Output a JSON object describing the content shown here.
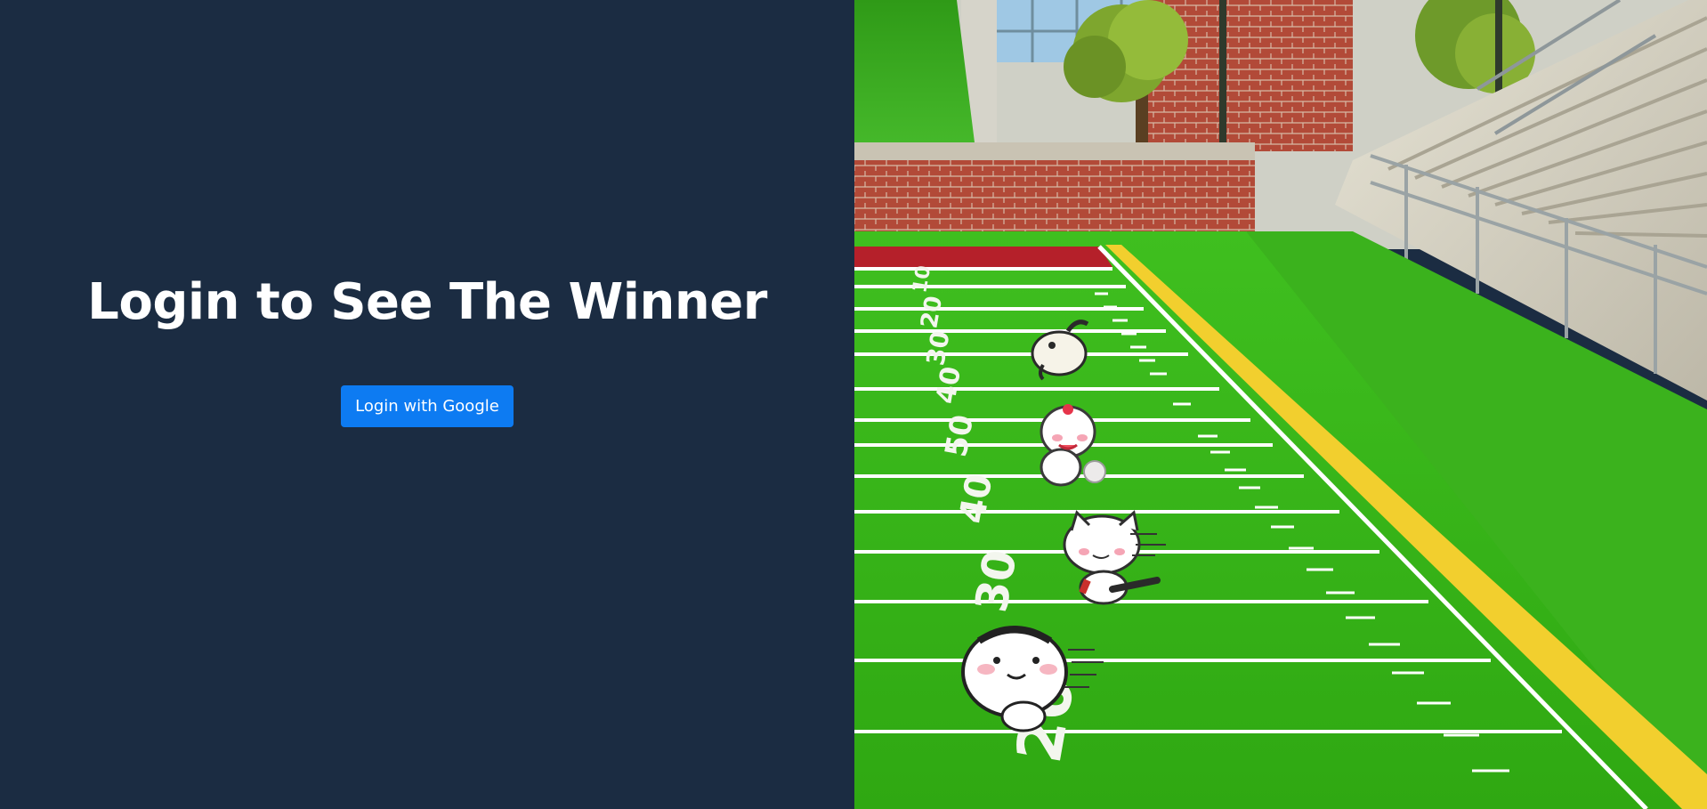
{
  "heading": "Login to See The Winner",
  "login_button_label": "Login with Google",
  "colors": {
    "background": "#1b2c42",
    "button": "#0d7bf2",
    "field_green": "#37b81c",
    "sideline_yellow": "#f2cf2e",
    "endzone_red": "#b5202a",
    "brick": "#b0493a"
  },
  "illustration": {
    "field_numbers": [
      "10",
      "20",
      "30",
      "40",
      "50",
      "40",
      "30",
      "20"
    ],
    "runners": [
      "goat-runner-icon",
      "bunny-runner-icon",
      "cat-runner-icon",
      "dumpling-runner-icon"
    ]
  }
}
